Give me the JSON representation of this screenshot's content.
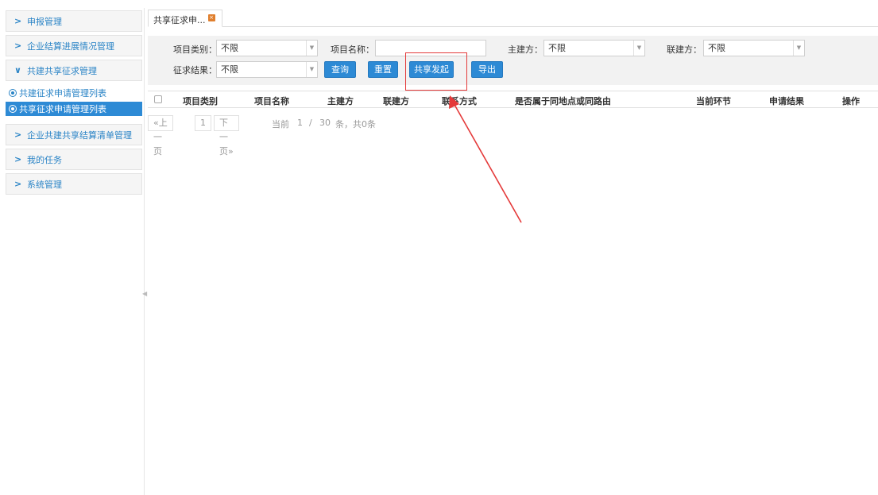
{
  "sidebar": {
    "groups": [
      {
        "label": "申报管理"
      },
      {
        "label": "企业结算进展情况管理"
      },
      {
        "label": "共建共享征求管理"
      },
      {
        "label": "企业共建共享结算清单管理"
      },
      {
        "label": "我的任务"
      },
      {
        "label": "系统管理"
      }
    ],
    "subitems": [
      {
        "label": "共建征求申请管理列表"
      },
      {
        "label": "共享征求申请管理列表"
      }
    ]
  },
  "tab": {
    "label": "共享征求申..."
  },
  "filters": {
    "project_type_label": "项目类别：",
    "project_type_value": "不限",
    "project_name_label": "项目名称：",
    "project_name_value": "",
    "main_builder_label": "主建方：",
    "main_builder_value": "不限",
    "joint_builder_label": "联建方：",
    "joint_builder_value": "不限",
    "result_label": "征求结果：",
    "result_value": "不限"
  },
  "buttons": {
    "query": "查询",
    "reset": "重置",
    "share_initiate": "共享发起",
    "export": "导出"
  },
  "table": {
    "headers": [
      "项目类别",
      "项目名称",
      "主建方",
      "联建方",
      "联系方式",
      "是否属于同地点或同路由",
      "当前环节",
      "申请结果",
      "操作"
    ]
  },
  "pagination": {
    "prev": "«上一页",
    "page": "1",
    "next": "下一页»",
    "current_label": "当前",
    "current_page": "1",
    "separator": "/",
    "total_pages": "30",
    "summary": "条，共0条"
  },
  "colors": {
    "accent": "#2d8ad5",
    "annotation": "#e43a3a"
  }
}
